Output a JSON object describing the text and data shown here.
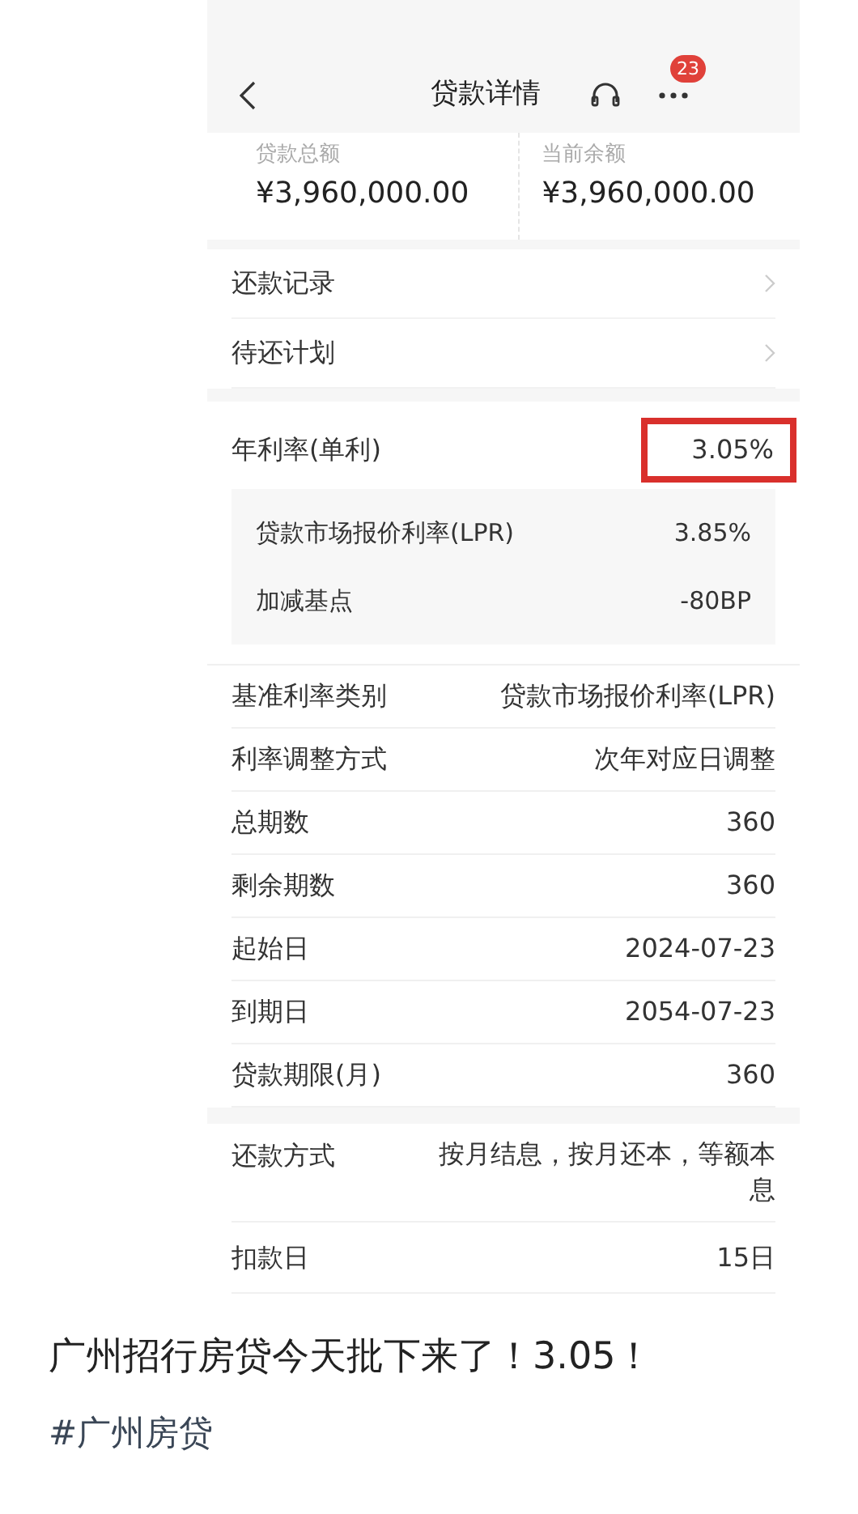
{
  "header": {
    "title": "贷款详情",
    "badge": "23"
  },
  "summary": [
    {
      "label": "贷款总额",
      "value": "¥3,960,000.00"
    },
    {
      "label": "当前余额",
      "value": "¥3,960,000.00"
    }
  ],
  "links": [
    {
      "label": "还款记录"
    },
    {
      "label": "待还计划"
    }
  ],
  "rate": {
    "label": "年利率(单利)",
    "value": "3.05%",
    "highlighted": true,
    "breakdown": [
      {
        "label": "贷款市场报价利率(LPR)",
        "value": "3.85%"
      },
      {
        "label": "加减基点",
        "value": "-80BP"
      }
    ]
  },
  "details": [
    {
      "label": "基准利率类别",
      "value": "贷款市场报价利率(LPR)"
    },
    {
      "label": "利率调整方式",
      "value": "次年对应日调整"
    },
    {
      "label": "总期数",
      "value": "360"
    },
    {
      "label": "剩余期数",
      "value": "360"
    },
    {
      "label": "起始日",
      "value": "2024-07-23"
    },
    {
      "label": "到期日",
      "value": "2054-07-23"
    },
    {
      "label": "贷款期限(月)",
      "value": "360"
    }
  ],
  "repayment": [
    {
      "label": "还款方式",
      "value": "按月结息，按月还本，等额本息"
    },
    {
      "label": "扣款日",
      "value": "15日"
    }
  ],
  "post": {
    "title": "广州招行房贷今天批下来了！3.05！",
    "hashtag": "#广州房贷"
  }
}
